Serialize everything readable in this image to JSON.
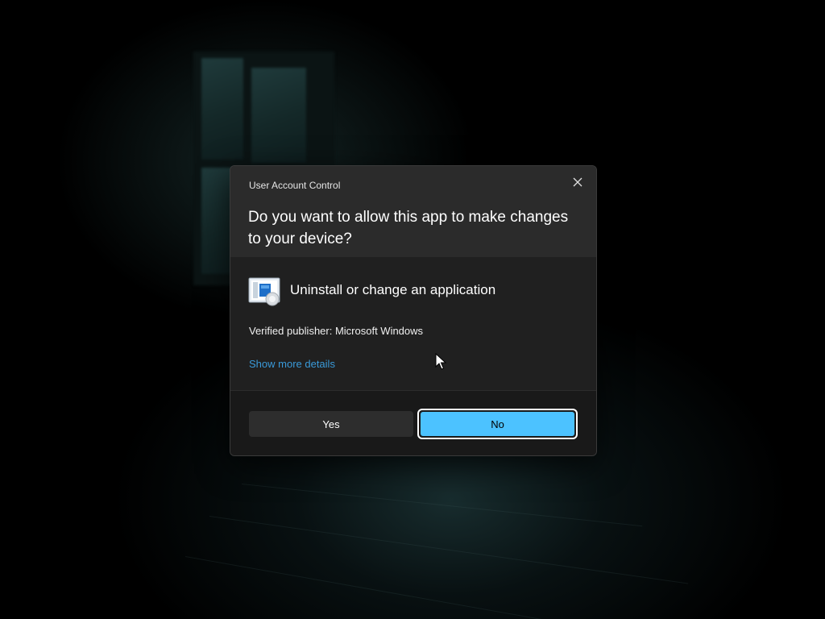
{
  "dialog": {
    "caption": "User Account Control",
    "question": "Do you want to allow this app to make changes to your device?",
    "app_name": "Uninstall or change an application",
    "publisher": "Verified publisher: Microsoft Windows",
    "more_details_link": "Show more details",
    "close_icon": "close-icon",
    "app_icon": "programs-and-features-icon"
  },
  "buttons": {
    "yes_label": "Yes",
    "no_label": "No"
  },
  "colors": {
    "accent": "#4cc2ff",
    "link": "#3a9ad9",
    "dialog_bg": "#202020",
    "header_bg": "#2b2b2b",
    "footer_bg": "#191919"
  }
}
